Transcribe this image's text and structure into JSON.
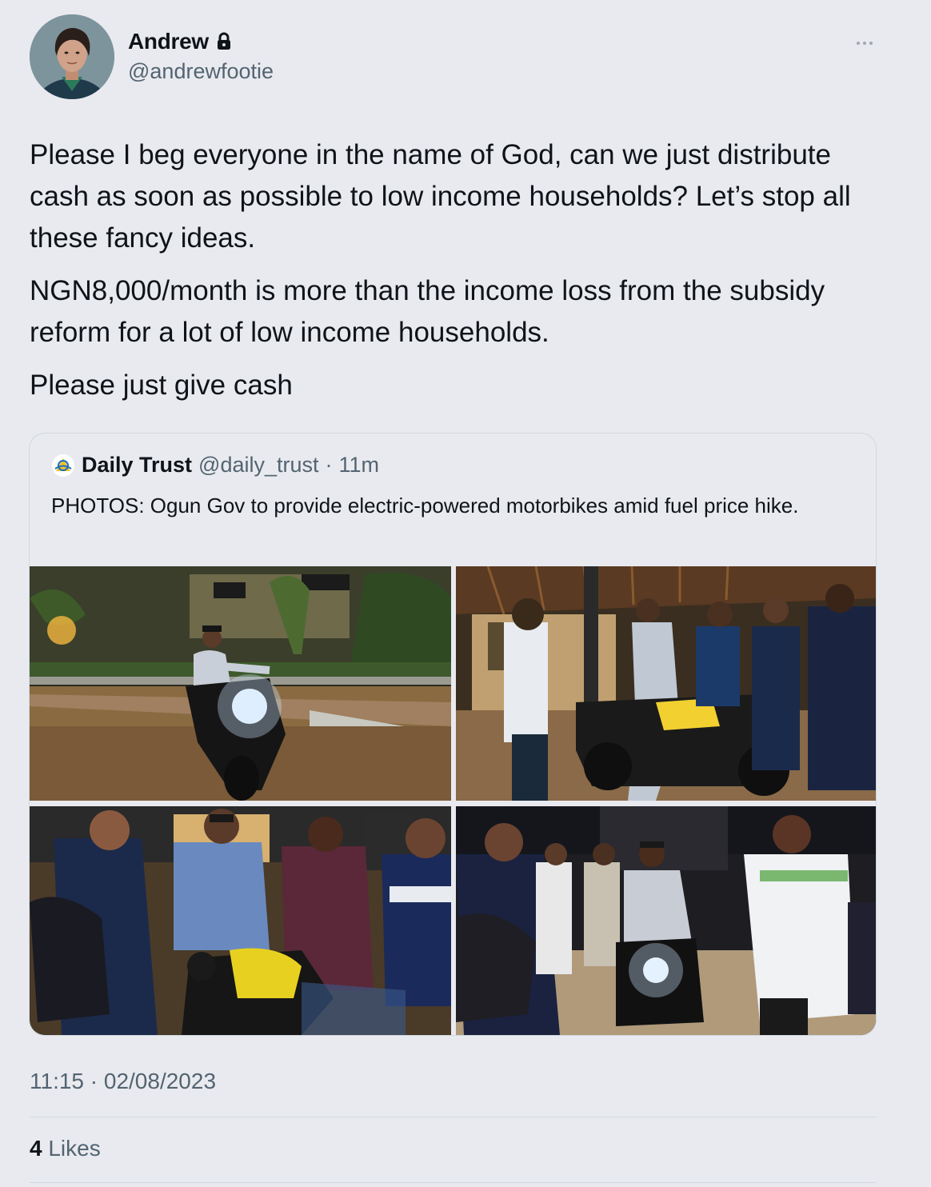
{
  "author": {
    "display_name": "Andrew",
    "handle": "@andrewfootie",
    "protected_icon": "lock-icon",
    "avatar_icon": "profile-photo"
  },
  "tweet": {
    "paragraphs": [
      "Please I beg everyone in the name of God, can we just distribute cash as soon as possible to low income households? Let’s stop all these fancy ideas.",
      "NGN8,000/month is more than the income loss from the subsidy reform for a lot of low income households.",
      "Please just give cash"
    ],
    "timestamp": "11:15 · 02/08/2023",
    "likes_count": "4",
    "likes_label": "Likes"
  },
  "quoted": {
    "name": "Daily Trust",
    "handle": "@daily_trust",
    "separator": "·",
    "time": "11m",
    "text": "PHOTOS: Ogun Gov to provide electric-powered motorbikes amid fuel price hike.",
    "photos": [
      "photo-man-riding-motorbike",
      "photo-group-around-motorbike",
      "photo-officials-yellow-bike",
      "photo-rider-headlight-crowd"
    ]
  },
  "colors": {
    "background": "#e9eaef",
    "text_primary": "#0f1419",
    "text_secondary": "#536471",
    "border": "#cfd9de"
  }
}
